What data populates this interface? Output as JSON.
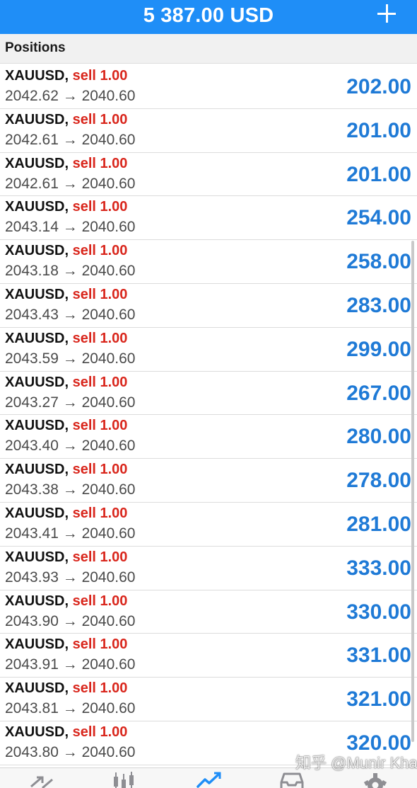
{
  "header": {
    "balance": "5 387.00 USD"
  },
  "section": {
    "title": "Positions"
  },
  "positions": [
    {
      "symbol": "XAUUSD,",
      "side": "sell 1.00",
      "prices": "2042.62 → 2040.60",
      "profit": "202.00"
    },
    {
      "symbol": "XAUUSD,",
      "side": "sell 1.00",
      "prices": "2042.61 → 2040.60",
      "profit": "201.00"
    },
    {
      "symbol": "XAUUSD,",
      "side": "sell 1.00",
      "prices": "2042.61 → 2040.60",
      "profit": "201.00"
    },
    {
      "symbol": "XAUUSD,",
      "side": "sell 1.00",
      "prices": "2043.14 → 2040.60",
      "profit": "254.00"
    },
    {
      "symbol": "XAUUSD,",
      "side": "sell 1.00",
      "prices": "2043.18 → 2040.60",
      "profit": "258.00"
    },
    {
      "symbol": "XAUUSD,",
      "side": "sell 1.00",
      "prices": "2043.43 → 2040.60",
      "profit": "283.00"
    },
    {
      "symbol": "XAUUSD,",
      "side": "sell 1.00",
      "prices": "2043.59 → 2040.60",
      "profit": "299.00"
    },
    {
      "symbol": "XAUUSD,",
      "side": "sell 1.00",
      "prices": "2043.27 → 2040.60",
      "profit": "267.00"
    },
    {
      "symbol": "XAUUSD,",
      "side": "sell 1.00",
      "prices": "2043.40 → 2040.60",
      "profit": "280.00"
    },
    {
      "symbol": "XAUUSD,",
      "side": "sell 1.00",
      "prices": "2043.38 → 2040.60",
      "profit": "278.00"
    },
    {
      "symbol": "XAUUSD,",
      "side": "sell 1.00",
      "prices": "2043.41 → 2040.60",
      "profit": "281.00"
    },
    {
      "symbol": "XAUUSD,",
      "side": "sell 1.00",
      "prices": "2043.93 → 2040.60",
      "profit": "333.00"
    },
    {
      "symbol": "XAUUSD,",
      "side": "sell 1.00",
      "prices": "2043.90 → 2040.60",
      "profit": "330.00"
    },
    {
      "symbol": "XAUUSD,",
      "side": "sell 1.00",
      "prices": "2043.91 → 2040.60",
      "profit": "331.00"
    },
    {
      "symbol": "XAUUSD,",
      "side": "sell 1.00",
      "prices": "2043.81 → 2040.60",
      "profit": "321.00"
    },
    {
      "symbol": "XAUUSD,",
      "side": "sell 1.00",
      "prices": "2043.80 → 2040.60",
      "profit": "320.00"
    }
  ],
  "tabbar": {
    "tabs": [
      {
        "icon": "quotes-icon",
        "active": false
      },
      {
        "icon": "chart-icon",
        "active": false
      },
      {
        "icon": "trade-icon",
        "active": true
      },
      {
        "icon": "history-icon",
        "active": false
      },
      {
        "icon": "settings-icon",
        "active": false
      }
    ]
  },
  "watermark": {
    "text": "知乎 @Munir Khan"
  },
  "colors": {
    "header_bg": "#1f8ef7",
    "sell": "#d9261c",
    "profit": "#1f7ad6",
    "active_tab": "#1f8ef7",
    "inactive_tab": "#8e8e93"
  }
}
